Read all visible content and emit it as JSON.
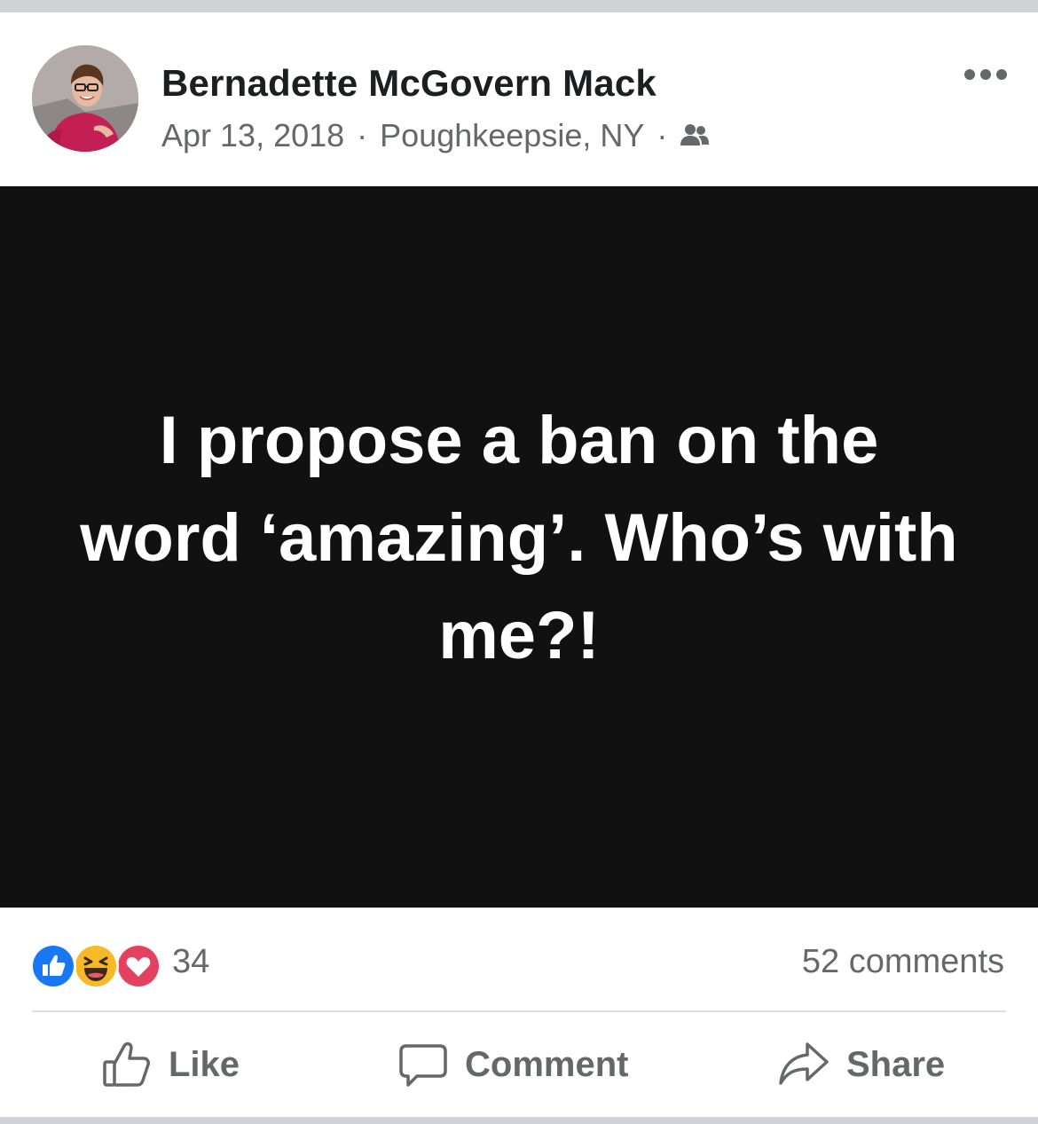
{
  "post": {
    "author": "Bernadette McGovern Mack",
    "date": "Apr 13, 2018",
    "separator": "·",
    "location": "Poughkeepsie, NY",
    "audience_icon": "friends-icon",
    "menu_icon": "more-options-icon",
    "text": "I propose a ban on the word ‘amazing’. Who’s with me?!",
    "background_color": "#111111",
    "text_color": "#ffffff"
  },
  "engagement": {
    "reaction_icons": [
      "like-reaction-icon",
      "haha-reaction-icon",
      "love-reaction-icon"
    ],
    "reaction_count": "34",
    "comments_label": "52 comments"
  },
  "actions": {
    "like_label": "Like",
    "comment_label": "Comment",
    "share_label": "Share"
  },
  "colors": {
    "like_blue": "#1877f2",
    "haha_yellow": "#f7b928",
    "love_red": "#e4405f",
    "secondary_text": "#65676b"
  }
}
